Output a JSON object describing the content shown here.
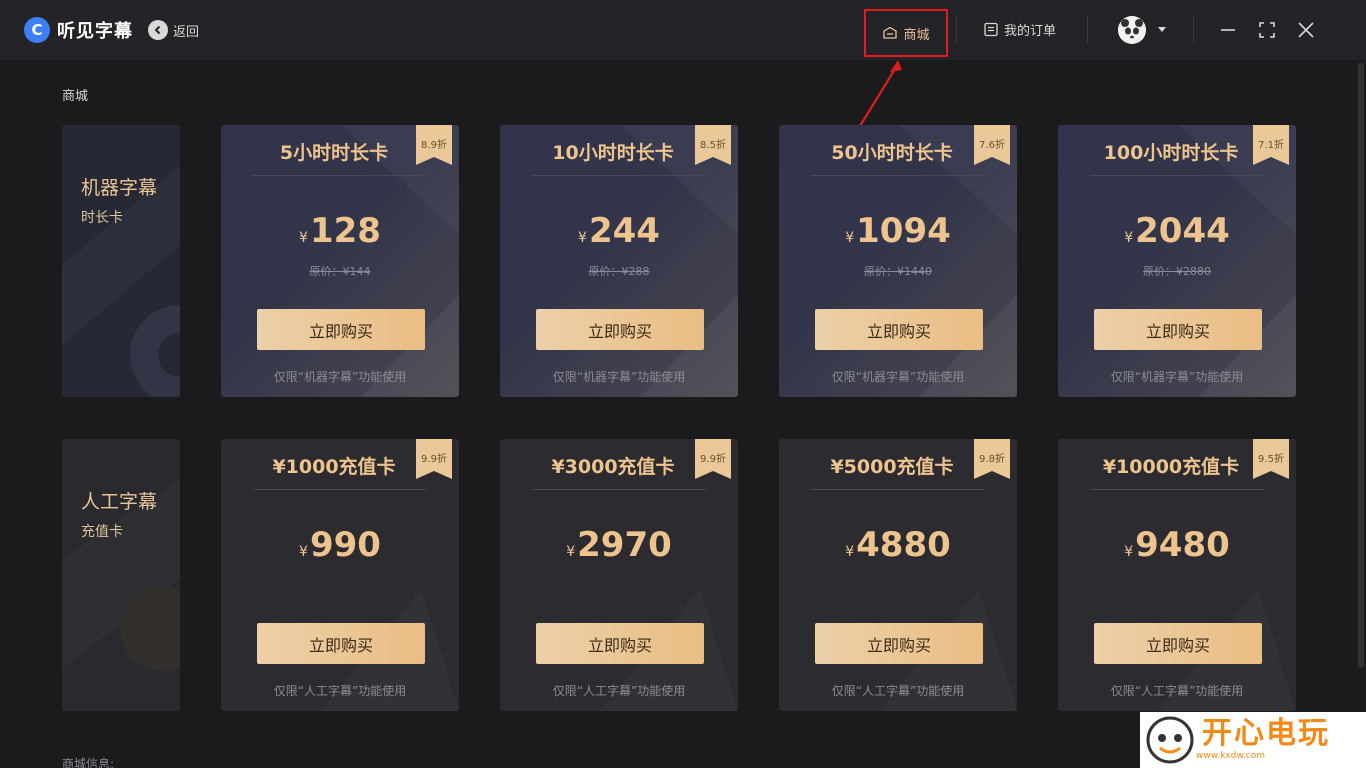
{
  "app": {
    "logo_glyph": "C",
    "name": "听见字幕",
    "back_label": "返回"
  },
  "header": {
    "store_label": "商城",
    "orders_label": "我的订单",
    "avatar_icon": "panda-avatar-icon",
    "highlight_color": "#e01d1d"
  },
  "page": {
    "breadcrumb": "商城",
    "info_label": "商城信息:"
  },
  "sections": [
    {
      "side_title": "机器字幕",
      "side_sub": "时长卡",
      "cards": [
        {
          "title": "5小时时长卡",
          "discount": "8.9折",
          "yen": "¥",
          "price": "128",
          "original": "原价：¥144",
          "buy": "立即购买",
          "note": "仅限“机器字幕”功能使用"
        },
        {
          "title": "10小时时长卡",
          "discount": "8.5折",
          "yen": "¥",
          "price": "244",
          "original": "原价：¥288",
          "buy": "立即购买",
          "note": "仅限“机器字幕”功能使用"
        },
        {
          "title": "50小时时长卡",
          "discount": "7.6折",
          "yen": "¥",
          "price": "1094",
          "original": "原价：¥1440",
          "buy": "立即购买",
          "note": "仅限“机器字幕”功能使用"
        },
        {
          "title": "100小时时长卡",
          "discount": "7.1折",
          "yen": "¥",
          "price": "2044",
          "original": "原价：¥2880",
          "buy": "立即购买",
          "note": "仅限“机器字幕”功能使用"
        }
      ]
    },
    {
      "side_title": "人工字幕",
      "side_sub": "充值卡",
      "cards": [
        {
          "title": "¥1000充值卡",
          "discount": "9.9折",
          "yen": "¥",
          "price": "990",
          "buy": "立即购买",
          "note": "仅限“人工字幕”功能使用"
        },
        {
          "title": "¥3000充值卡",
          "discount": "9.9折",
          "yen": "¥",
          "price": "2970",
          "buy": "立即购买",
          "note": "仅限“人工字幕”功能使用"
        },
        {
          "title": "¥5000充值卡",
          "discount": "9.8折",
          "yen": "¥",
          "price": "4880",
          "buy": "立即购买",
          "note": "仅限“人工字幕”功能使用"
        },
        {
          "title": "¥10000充值卡",
          "discount": "9.5折",
          "yen": "¥",
          "price": "9480",
          "buy": "立即购买",
          "note": "仅限“人工字幕”功能使用"
        }
      ]
    }
  ],
  "watermark": {
    "text": "开心电玩",
    "site": "www.kxdw.com"
  }
}
